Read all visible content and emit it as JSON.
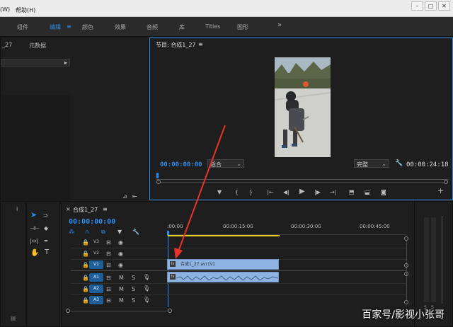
{
  "menubar": {
    "item_view": "(W)",
    "item_help": "帮助(H)"
  },
  "workspaces": {
    "items": [
      "组件",
      "编辑",
      "颜色",
      "效果",
      "音频",
      "库",
      "Titles",
      "图形"
    ],
    "more": "»",
    "active_index": 1,
    "menu_glyph": "≡"
  },
  "source_panel": {
    "tab_left": "_27",
    "tab_meta": "元数据",
    "arrow": "▸"
  },
  "program_monitor": {
    "title": "节目: 合成1_27",
    "menu_glyph": "≡",
    "timecode_current": "00:00:00:00",
    "fit_select": "适合",
    "quality_select": "完整",
    "timecode_duration": "00:00:24:18"
  },
  "project_panel": {
    "tab": "i"
  },
  "timeline": {
    "sequence_tab": "合成1_27",
    "menu_glyph": "≡",
    "close_glyph": "×",
    "timecode": "00:00:00:00",
    "ruler_labels": [
      ":00:00",
      "00:00:15:00",
      "00:00:30:00",
      "00:00:45:00"
    ],
    "video_tracks": [
      "V3",
      "V2",
      "V1"
    ],
    "audio_tracks": [
      "A1",
      "A2",
      "A3"
    ],
    "audio_buttons": [
      "M",
      "S"
    ],
    "clip_video_label": "合成1_27.avi [V]",
    "clip_fx": "fx"
  },
  "meter": {
    "labels": [
      "S",
      "S"
    ]
  },
  "watermark": "百家号/影视小张哥",
  "colors": {
    "accent": "#2d8ceb",
    "clip": "#8fb3e0",
    "playhead_yellow": "#e6d21c",
    "arrow_red": "#e8322a"
  }
}
